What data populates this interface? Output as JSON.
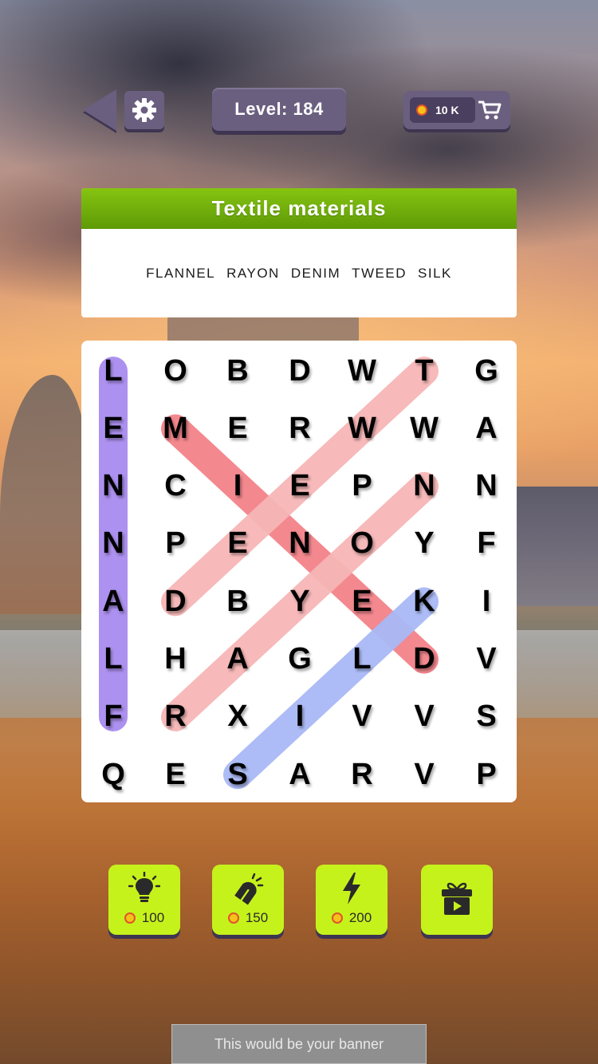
{
  "header": {
    "level_label": "Level: 184",
    "coins_label": "10 K"
  },
  "category": {
    "title": "Textile materials",
    "words": [
      "FLANNEL",
      "RAYON",
      "DENIM",
      "TWEED",
      "SILK"
    ]
  },
  "grid": {
    "rows": [
      [
        "L",
        "O",
        "B",
        "D",
        "W",
        "T",
        "G"
      ],
      [
        "E",
        "M",
        "E",
        "R",
        "W",
        "W",
        "A"
      ],
      [
        "N",
        "C",
        "I",
        "E",
        "P",
        "N",
        "N"
      ],
      [
        "N",
        "P",
        "E",
        "N",
        "O",
        "Y",
        "F"
      ],
      [
        "A",
        "D",
        "B",
        "Y",
        "E",
        "K",
        "I"
      ],
      [
        "L",
        "H",
        "A",
        "G",
        "L",
        "D",
        "V"
      ],
      [
        "F",
        "R",
        "X",
        "I",
        "V",
        "V",
        "S"
      ],
      [
        "Q",
        "E",
        "S",
        "A",
        "R",
        "V",
        "P"
      ]
    ],
    "found_words": [
      {
        "word": "FLANNEL",
        "start": [
          6,
          0
        ],
        "end": [
          0,
          0
        ],
        "color": "#a98cf0"
      },
      {
        "word": "DENIM",
        "start": [
          5,
          5
        ],
        "end": [
          1,
          1
        ],
        "color": "#f4828a"
      },
      {
        "word": "TWEED",
        "start": [
          0,
          5
        ],
        "end": [
          4,
          1
        ],
        "color": "#f7b6b6"
      },
      {
        "word": "RAYON",
        "start": [
          6,
          1
        ],
        "end": [
          2,
          5
        ],
        "color": "#f7b6b6"
      },
      {
        "word": "SILK",
        "start": [
          7,
          2
        ],
        "end": [
          4,
          5
        ],
        "color": "#a9b9f6"
      }
    ]
  },
  "powerups": [
    {
      "icon": "lightbulb-icon",
      "price": "100"
    },
    {
      "icon": "magnet-icon",
      "price": "150"
    },
    {
      "icon": "lightning-icon",
      "price": "200"
    },
    {
      "icon": "gift-video-icon",
      "price": ""
    }
  ],
  "banner": {
    "text": "This would be your banner"
  },
  "colors": {
    "panel_purple": "#6b5f80",
    "category_green": "#6aaa08",
    "powerup_lime": "#c6f21c"
  }
}
